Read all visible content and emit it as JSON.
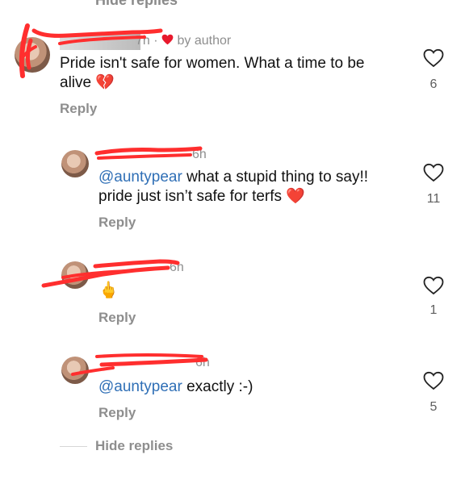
{
  "top_partial_label": "Hide replies",
  "comments": [
    {
      "time": "7h",
      "author_badge": "by author",
      "text": "Pride isn't safe for women. What a time to be alive",
      "emoji": "💔",
      "reply_label": "Reply",
      "like_count": "6"
    },
    {
      "time": "6h",
      "mention": "@auntypear",
      "text": " what a stupid thing to say!! pride just isn’t safe for terfs ",
      "emoji": "❤️",
      "reply_label": "Reply",
      "like_count": "11"
    },
    {
      "time": "6h",
      "emoji": "🖕",
      "reply_label": "Reply",
      "like_count": "1"
    },
    {
      "time": "6h",
      "mention": "@auntypear",
      "text": " exactly :-)",
      "reply_label": "Reply",
      "like_count": "5"
    }
  ],
  "hide_replies_label": "Hide replies",
  "colors": {
    "redaction": "#ff2e2e",
    "heart": "#e8192c",
    "mention": "#2f6fb6",
    "muted": "#8e8e8e"
  },
  "icons": [
    "heart-outline-icon",
    "heart-filled-icon"
  ]
}
